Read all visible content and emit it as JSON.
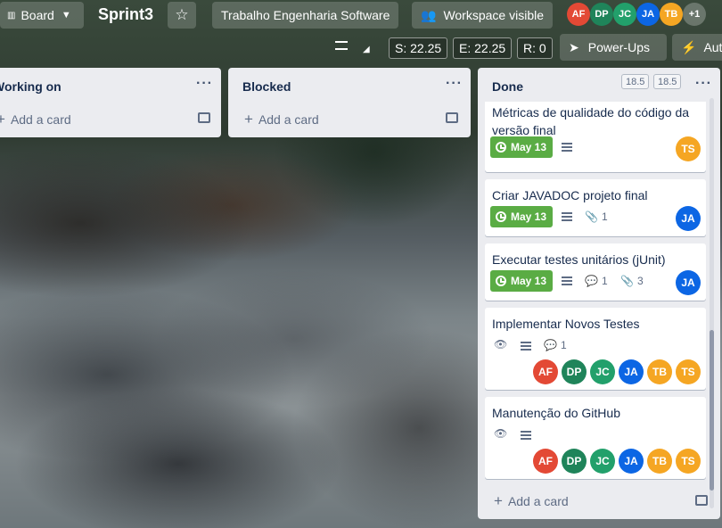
{
  "header": {
    "view_switcher": "Board",
    "board_title": "Sprint3",
    "workspace_name": "Trabalho Engenharia Software",
    "visibility": "Workspace visible",
    "members": [
      {
        "initials": "AF",
        "color": "#e34935"
      },
      {
        "initials": "DP",
        "color": "#1f845a"
      },
      {
        "initials": "JC",
        "color": "#22a06b"
      },
      {
        "initials": "JA",
        "color": "#0c66e4"
      },
      {
        "initials": "TB",
        "color": "#f5a623"
      }
    ],
    "more_members": "+1"
  },
  "subbar": {
    "start": "S: 22.25",
    "end": "E: 22.25",
    "remaining": "R: 0",
    "power_ups": "Power-Ups",
    "automation": "Aut"
  },
  "lists": [
    {
      "title": "Working on",
      "add_card": "Add a card"
    },
    {
      "title": "Blocked",
      "add_card": "Add a card"
    },
    {
      "title": "Done",
      "counter_a": "18.5",
      "counter_b": "18.5",
      "add_card": "Add a card",
      "cards": [
        {
          "title": "Métricas de qualidade do código da versão final",
          "due": "May 13",
          "members": [
            "TS"
          ]
        },
        {
          "title": "Criar JAVADOC projeto final",
          "due": "May 13",
          "attachments": "1",
          "members": [
            "JA"
          ]
        },
        {
          "title": "Executar testes unitários (jUnit)",
          "due": "May 13",
          "comments": "1",
          "attachments": "3",
          "members": [
            "JA"
          ]
        },
        {
          "title": "Implementar Novos Testes",
          "comments": "1",
          "members": [
            "AF",
            "DP",
            "JC",
            "JA",
            "TB",
            "TS"
          ]
        },
        {
          "title": "Manutenção do GitHub",
          "members": [
            "AF",
            "DP",
            "JC",
            "JA",
            "TB",
            "TS"
          ]
        }
      ]
    }
  ],
  "member_colors": {
    "AF": "#e34935",
    "DP": "#1f845a",
    "JC": "#22a06b",
    "JA": "#0c66e4",
    "TB": "#f5a623",
    "TS": "#f5a623"
  }
}
